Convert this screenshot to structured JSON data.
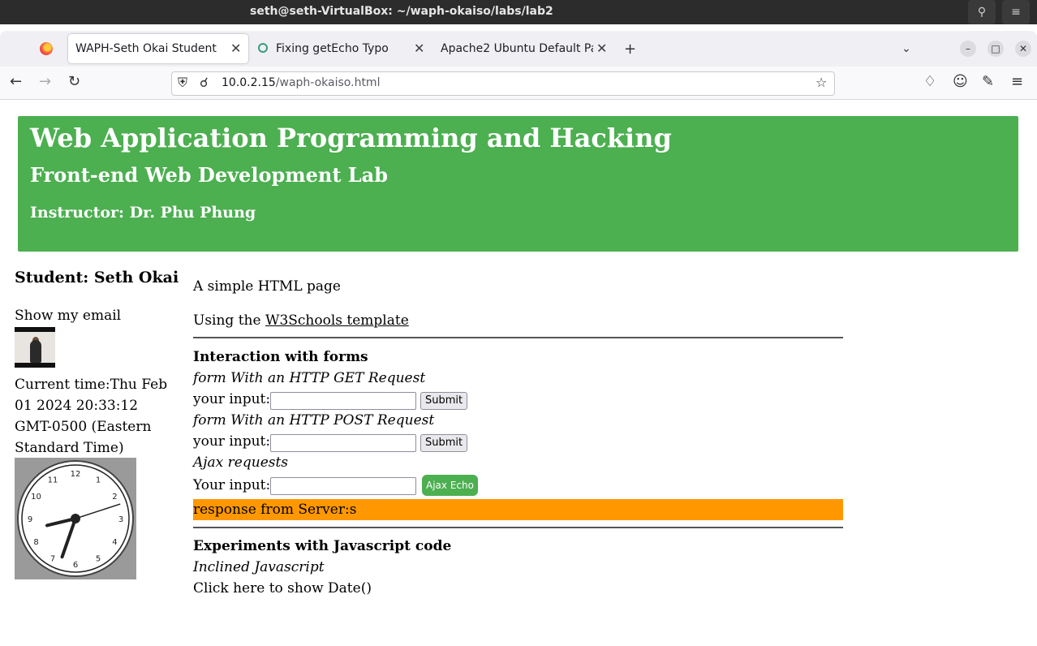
{
  "window": {
    "title": "seth@seth-VirtualBox: ~/waph-okaiso/labs/lab2"
  },
  "tabs": [
    {
      "label": "WAPH-Seth Okai Student",
      "active": true
    },
    {
      "label": "Fixing getEcho Typo",
      "active": false
    },
    {
      "label": "Apache2 Ubuntu Default Page",
      "active": false
    }
  ],
  "address": {
    "host": "10.0.2.15",
    "path": "/waph-okaiso.html"
  },
  "banner": {
    "title": "Web Application Programming and Hacking",
    "subtitle": "Front-end Web Development Lab",
    "instructor": "Instructor: Dr. Phu Phung"
  },
  "sidebar": {
    "student": "Student: Seth Okai",
    "email_link": "Show my email",
    "time_text": "Current time:Thu Feb 01 2024 20:33:12 GMT-0500 (Eastern Standard Time)",
    "clock": {
      "hours": 8,
      "minutes": 33,
      "seconds": 12,
      "numbers": [
        "12",
        "1",
        "2",
        "3",
        "4",
        "5",
        "6",
        "7",
        "8",
        "9",
        "10",
        "11"
      ]
    }
  },
  "main": {
    "intro": "A simple HTML page",
    "template_prefix": "Using the ",
    "template_link": "W3Schools template",
    "forms_heading": "Interaction with forms",
    "get_label": "form With an HTTP GET Request",
    "input_label": "your input:",
    "submit_label": "Submit",
    "post_label": "form With an HTTP POST Request",
    "ajax_label": "Ajax requests",
    "ajax_input_label": "Your input:",
    "ajax_button": "Ajax Echo",
    "response": "response from Server:s",
    "js_heading": "Experiments with Javascript code",
    "inline_js": "Inclined Javascript",
    "show_date": "Click here to show Date()"
  },
  "colors": {
    "banner": "#4caf50",
    "response": "#ff9800",
    "ajax_button": "#4caf50"
  }
}
